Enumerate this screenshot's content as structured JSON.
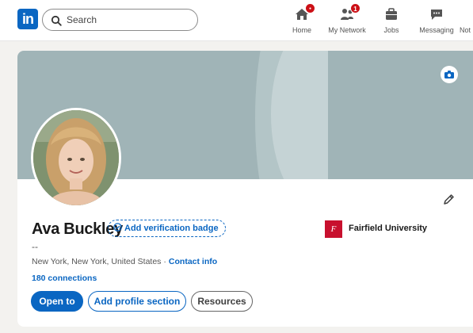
{
  "nav": {
    "logo_text": "in",
    "search_placeholder": "Search",
    "items": [
      {
        "label": "Home",
        "icon": "home-icon",
        "badge": "●"
      },
      {
        "label": "My Network",
        "icon": "my-network-icon",
        "badge": "1"
      },
      {
        "label": "Jobs",
        "icon": "briefcase-icon"
      },
      {
        "label": "Messaging",
        "icon": "messaging-icon"
      },
      {
        "label": "Not",
        "icon": "notifications-icon"
      }
    ]
  },
  "profile": {
    "name": "Ava Buckley",
    "verification_label": "Add verification badge",
    "headline": "--",
    "location": "New York, New York, United States",
    "separator": "·",
    "contact_info": "Contact info",
    "connections": "180 connections",
    "education": {
      "name": "Fairfield University",
      "logo_text": "F"
    },
    "buttons": {
      "open_to": "Open to",
      "add_section": "Add profile section",
      "resources": "Resources"
    }
  },
  "colors": {
    "brand": "#0a66c2",
    "badge": "#cc1016",
    "banner": "#a0b4b7",
    "school": "#c8102e"
  }
}
